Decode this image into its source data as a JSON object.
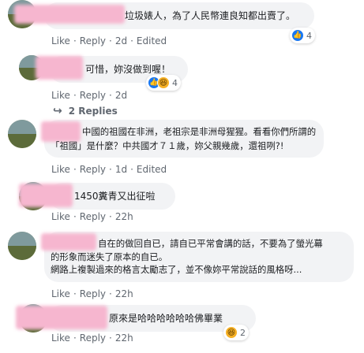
{
  "comments": [
    {
      "text": "垃圾婊人，為了人民幣連良知都出賣了。",
      "actions": {
        "like": "Like",
        "reply": "Reply",
        "time": "2d",
        "edited": "Edited"
      },
      "reactions": {
        "count": "4"
      }
    },
    {
      "text": "可惜，妳沒做到喔！",
      "actions": {
        "like": "Like",
        "reply": "Reply",
        "time": "2d"
      },
      "reactions": {
        "count": "4"
      }
    },
    {
      "replies_label": "2 Replies"
    },
    {
      "line1": "中國的祖國在非洲，老祖宗是非洲母猩猩。看看你們所謂的",
      "line2": "「祖國」是什麼？中共國才７１歲，妳父親幾歲，還祖咧?!",
      "actions": {
        "like": "Like",
        "reply": "Reply",
        "time": "1d",
        "edited": "Edited"
      }
    },
    {
      "text": "1450糞青又出征啦",
      "actions": {
        "like": "Like",
        "reply": "Reply",
        "time": "22h"
      }
    },
    {
      "line1": "自在的做回自已，請自已平常會講的話，不要為了螢光幕",
      "line2": "的形象而迷失了原本的自已。",
      "line3": "網路上複製過來的格言太勵志了，並不像妳平常說話的風格呀...",
      "actions": {
        "like": "Like",
        "reply": "Reply",
        "time": "22h"
      }
    },
    {
      "text": "原來是哈哈哈哈哈哈佛畢業",
      "actions": {
        "like": "Like",
        "reply": "Reply",
        "time": "22h"
      },
      "reactions": {
        "count": "2"
      }
    }
  ],
  "icons": {
    "like": "like-icon",
    "haha": "haha-icon",
    "reply_arrow": "reply-arrow-icon"
  },
  "colors": {
    "bubble": "#f2f3f5",
    "blur": "#f6b6cf",
    "like_blue": "#1877f2",
    "haha_yellow": "#f7b125",
    "meta": "#606770"
  }
}
